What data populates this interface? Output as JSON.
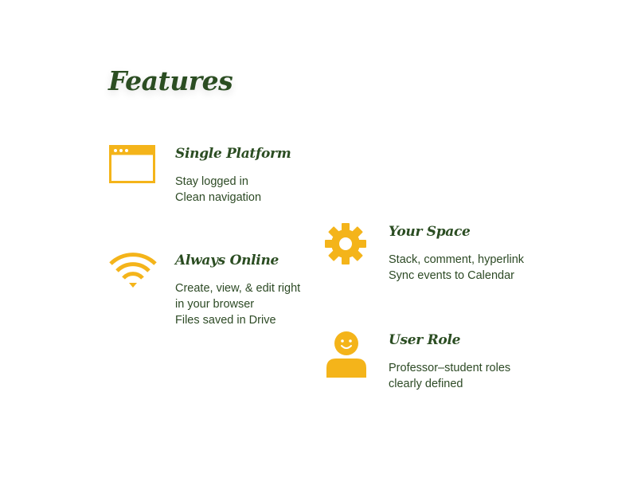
{
  "page": {
    "title": "Features"
  },
  "colors": {
    "accent": "#F4B41A",
    "heading": "#2B4D22",
    "text": "#2D4A25"
  },
  "features": [
    {
      "icon": "browser-window-icon",
      "title": "Single Platform",
      "lines": [
        "Stay logged in",
        "Clean navigation"
      ]
    },
    {
      "icon": "wifi-icon",
      "title": "Always Online",
      "lines": [
        "Create, view, & edit right",
        "in your browser",
        "Files saved in Drive"
      ]
    },
    {
      "icon": "gear-icon",
      "title": "Your Space",
      "lines": [
        "Stack, comment, hyperlink",
        "Sync events to Calendar"
      ]
    },
    {
      "icon": "user-icon",
      "title": "User Role",
      "lines": [
        "Professor–student roles",
        "clearly defined"
      ]
    }
  ]
}
